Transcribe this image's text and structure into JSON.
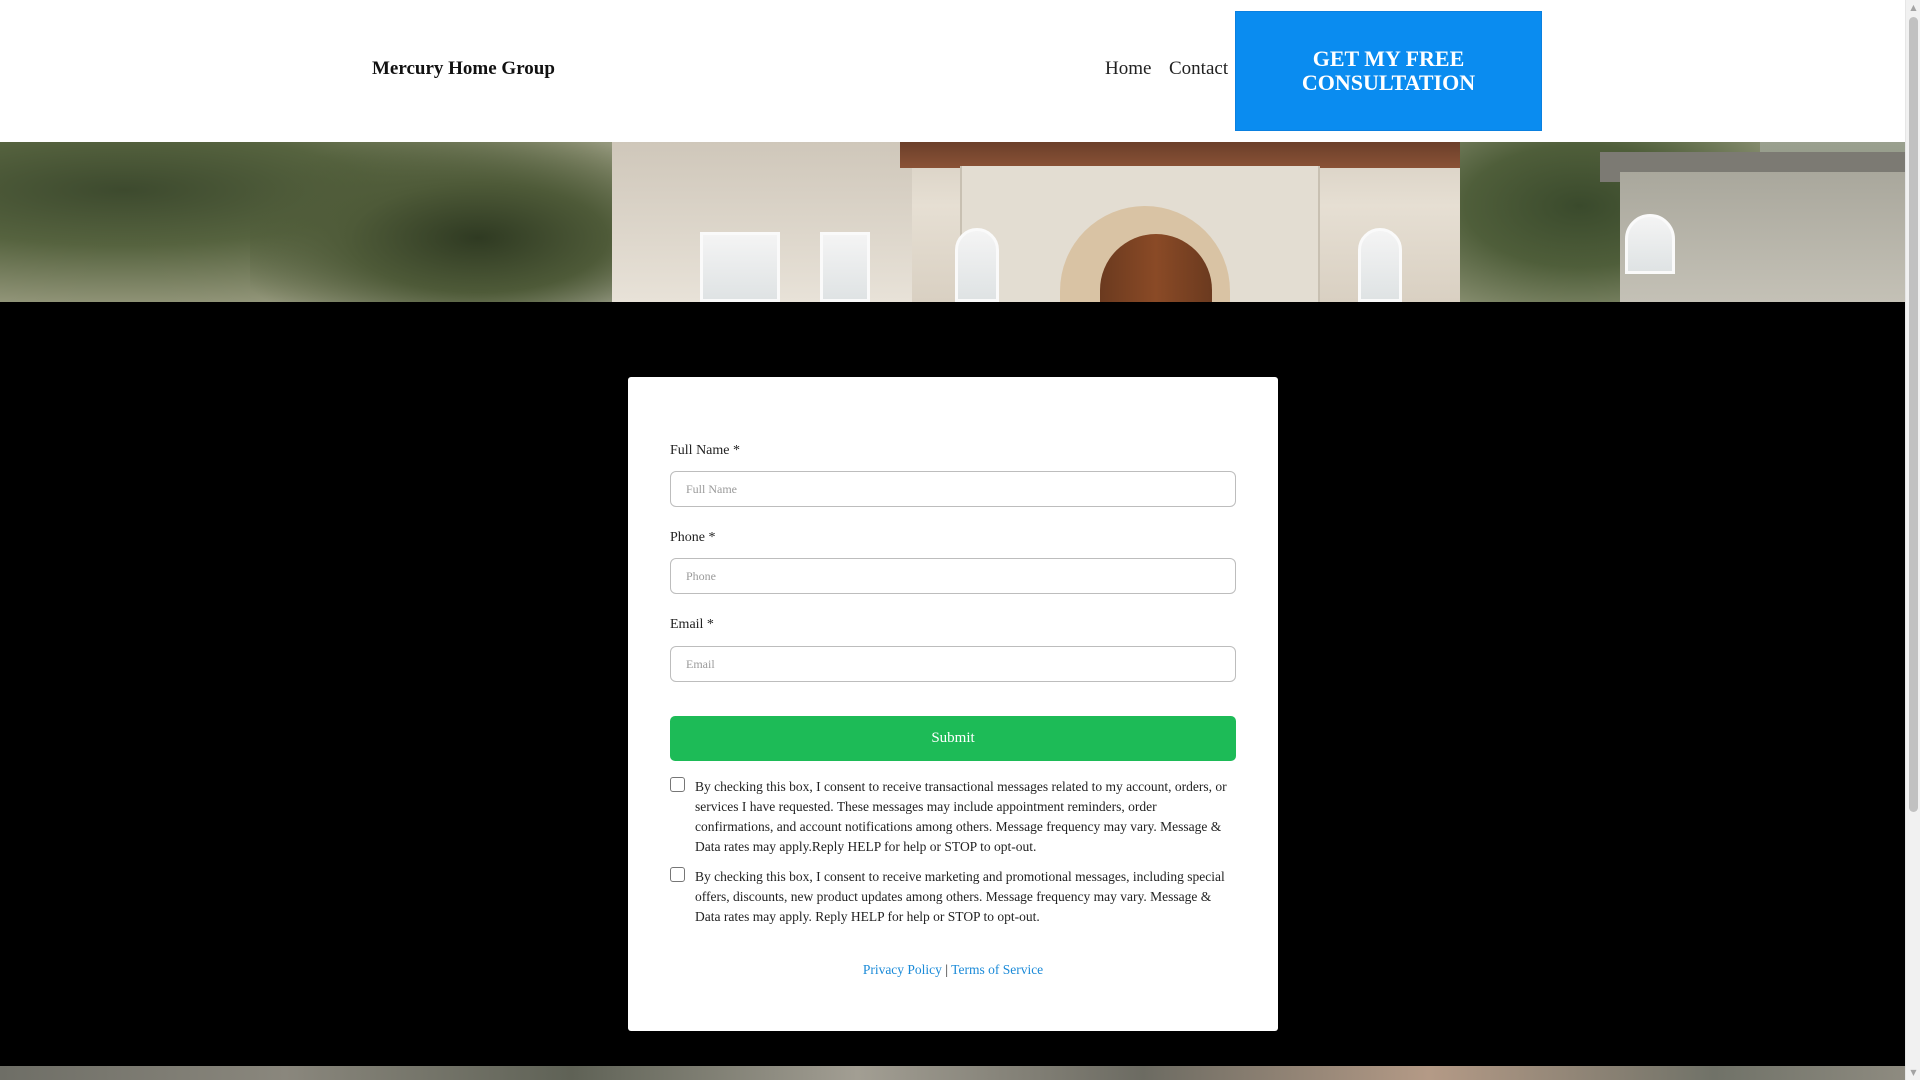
{
  "header": {
    "brand": "Mercury Home Group",
    "nav": [
      {
        "label": "Home"
      },
      {
        "label": "Contact"
      }
    ],
    "cta_label": "GET MY FREE CONSULTATION",
    "cta_color": "#0a8cf0"
  },
  "form": {
    "fields": [
      {
        "label": "Full Name *",
        "placeholder": "Full Name",
        "value": ""
      },
      {
        "label": "Phone *",
        "placeholder": "Phone",
        "value": ""
      },
      {
        "label": "Email *",
        "placeholder": "Email",
        "value": ""
      }
    ],
    "submit_label": "Submit",
    "submit_color": "#1dbb57",
    "consents": [
      {
        "checked": false,
        "text": "By checking this box, I consent to receive transactional messages related to my account, orders, or services I have requested. These messages may include appointment reminders, order confirmations, and account notifications among others. Message frequency may vary. Message & Data rates may apply.Reply HELP for help or STOP to opt-out."
      },
      {
        "checked": false,
        "text": "By checking this box, I consent to receive marketing and promotional messages, including special offers, discounts, new product updates among others. Message frequency may vary. Message & Data rates may apply. Reply HELP for help or STOP to opt-out."
      }
    ],
    "links": {
      "privacy": "Privacy Policy",
      "separator": "|",
      "terms": "Terms of Service",
      "link_color": "#1a8ad8"
    }
  }
}
